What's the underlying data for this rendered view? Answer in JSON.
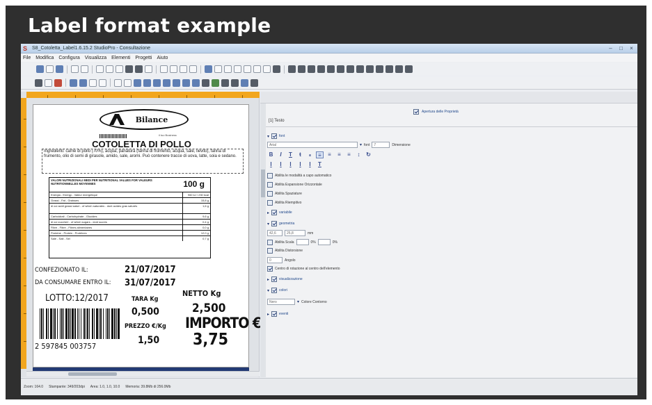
{
  "headline": "Label format example",
  "window": {
    "title": "S8_Cotoletta_Label1.6.15.2 StudioPro - Consultazione",
    "controls": [
      "–",
      "□",
      "×"
    ]
  },
  "menu": [
    "File",
    "Modifica",
    "Configura",
    "Visualizza",
    "Elementi",
    "Progetti",
    "Aiuto"
  ],
  "label": {
    "brand": "Bilance",
    "brand_tagline": "il tuo Business",
    "product_name": "COTOLETTA DI POLLO",
    "ingredients": "Ingredienti: carne di pollo (70%), acqua, panatura (farina di frumento, acqua, sale, lievito), farina di frumento, olio di semi di girasole, amido, sale, aromi. Può contenere tracce di uova, latte, soia e sedano.",
    "nutrition": {
      "header": "VALORI NUTRIZIONALI MEDI PER NUTRITIONAL VALUES FOR VALEURS NUTRITIONNELLES MOYENNES",
      "quantity": "100 g",
      "rows": [
        {
          "k": "Energia - Energy - Valeur energetique",
          "v": "960 kJ / 230 kcal"
        },
        {
          "k": "Grassi - Fat - Graisses",
          "v": "15,8 g"
        },
        {
          "k": "di cui acidi grassi saturi - of which saturates - dont acides gras saturés",
          "v": "1,6 g"
        },
        {
          "k": "Carboidrati - Carbohydrate - Glucides",
          "v": "9,6 g"
        },
        {
          "k": "di cui zuccheri - of which sugars - dont sucres",
          "v": "0,4 g"
        },
        {
          "k": "Fibre - Fibre - Fibres alimentaires",
          "v": "0,0 g"
        },
        {
          "k": "Proteine - Protein - Protéines",
          "v": "12,0 g"
        },
        {
          "k": "Sale - Salt - Sel",
          "v": "0,7 g"
        }
      ]
    },
    "packed_label": "CONFEZIONATO IL:",
    "packed_date": "21/07/2017",
    "expiry_label": "DA CONSUMARE ENTRO IL:",
    "expiry_date": "31/07/2017",
    "net_label": "NETTO Kg",
    "net_value": "2,500",
    "lot": "LOTTO:12/2017",
    "tare_label": "TARA Kg",
    "tare_value": "0,500",
    "total_label": "IMPORTO €",
    "price_label": "PREZZO €/Kg",
    "price_value": "1,50",
    "total_value": "3,75",
    "barcode_digits": "2  597845  003757"
  },
  "properties": {
    "header": "Apertura delle Proprietà",
    "tab": "[1] Testo",
    "font_section": "font",
    "font_name": "Arial",
    "font_size_label": "font",
    "font_size": "7",
    "scale_label": "Dimensione",
    "options": [
      "Abilita le modalità a capo automatico",
      "Abilita Espansione Orizzontale",
      "Abilita Spaziature",
      "Abilita Riempitivo"
    ],
    "variable_section": "variabile",
    "geometry_section": "geometria",
    "geo_x": "42,6",
    "geo_y": "25,8",
    "geo_unit": "mm",
    "scale_option": "Abilita Scala",
    "scale_x": "0%",
    "scale_y": "0%",
    "distort_option": "Abilita Distorsione",
    "angle_value": "0",
    "angle_label": "Angolo",
    "rotate_center": "Centro di rotazione al centro dell'elemento",
    "viewtext_section": "visualizzazione",
    "colors_section": "colori",
    "color_value": "Nero",
    "color_label": "Colore Contorno",
    "events_section": "eventi"
  },
  "status": {
    "zoom": "Zoom: 164.0",
    "printer": "Stampante: 349/203dpi",
    "area": "Area: 1.0, 1.0, 10.0",
    "memory": "Memoria: 39.8Mb di 256.0Mb"
  },
  "colors": {
    "frame": "#2f2f2f",
    "ruler": "#f2a61e",
    "accent": "#233a74"
  }
}
